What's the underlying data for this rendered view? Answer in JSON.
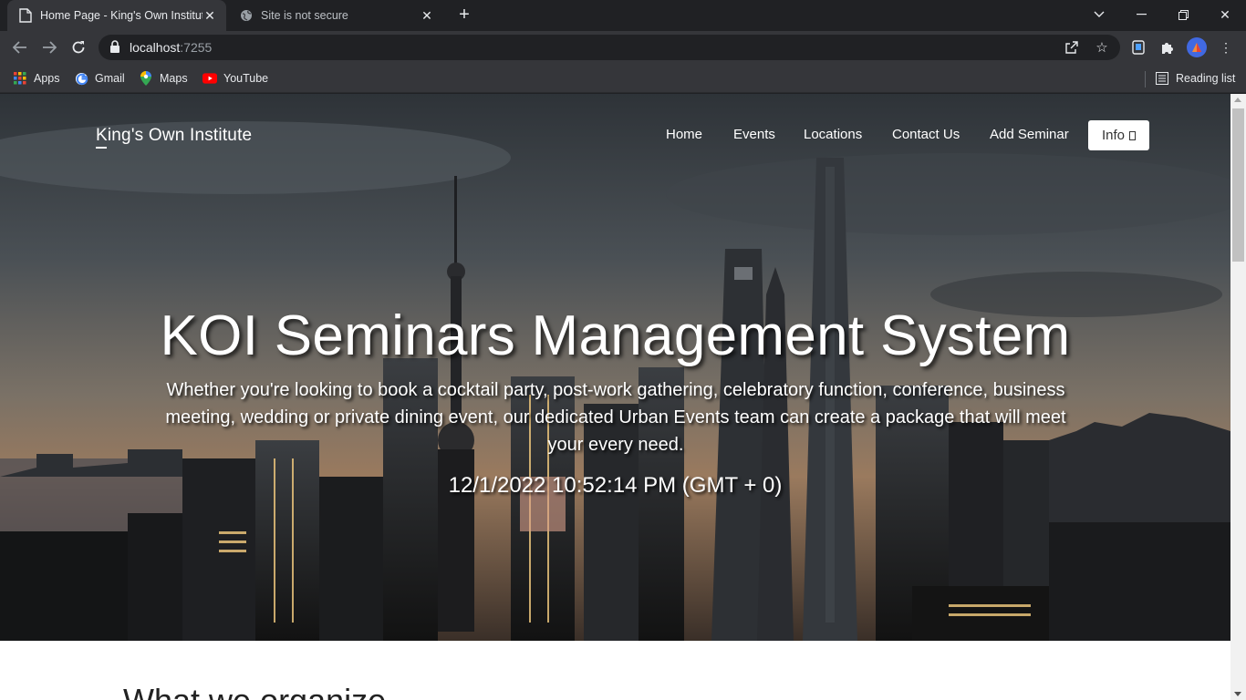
{
  "browser": {
    "tabs": [
      {
        "title": "Home Page - King's Own Institute",
        "active": true
      },
      {
        "title": "Site is not secure",
        "active": false
      }
    ],
    "address": {
      "host": "localhost",
      "port": ":7255"
    },
    "bookmarks": [
      "Apps",
      "Gmail",
      "Maps",
      "YouTube"
    ],
    "reading_list": "Reading list"
  },
  "site": {
    "brand": "King's Own Institute",
    "nav": [
      "Home",
      "Events",
      "Locations",
      "Contact Us",
      "Add Seminar"
    ],
    "info_button": "Info",
    "hero": {
      "title": "KOI Seminars Management System",
      "subtitle": "Whether you're looking to book a cocktail party, post-work gathering, celebratory function, conference, business meeting, wedding or private dining event, our dedicated Urban Events team can create a package that will meet your every need.",
      "datetime": "12/1/2022 10:52:14 PM (GMT + 0)"
    },
    "section_heading": "What we organize"
  },
  "colors": {
    "chrome_dark": "#202124",
    "chrome_toolbar": "#35363a",
    "profile_avatar": "#4169e1"
  }
}
